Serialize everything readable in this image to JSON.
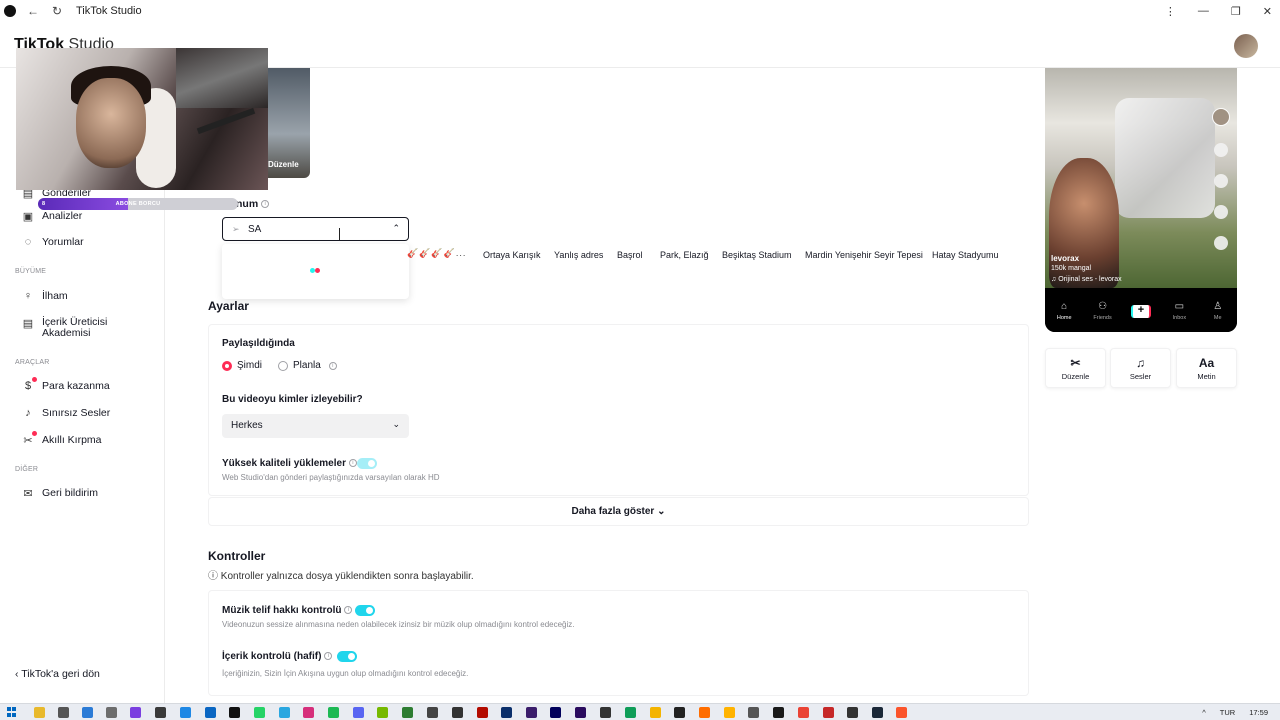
{
  "window": {
    "title": "TikTok Studio",
    "back_icon": "←",
    "reload_icon": "↻",
    "controls": [
      "⋮",
      "—",
      "❐",
      "✕"
    ]
  },
  "header": {
    "logo_text": "TikTok",
    "logo_suffix": "Studio"
  },
  "sidebar": {
    "items": [
      {
        "label": "Analizler",
        "icon": "analytics-icon",
        "glyph": "▣"
      },
      {
        "label": "Yorumlar",
        "icon": "comment-icon",
        "glyph": "◌"
      },
      {
        "label": "İlham",
        "icon": "lightbulb-icon",
        "glyph": "♀"
      },
      {
        "label": "İçerik Üreticisi",
        "label2": "Akademisi",
        "icon": "academy-icon",
        "glyph": "▤"
      },
      {
        "label": "Para kazanma",
        "icon": "money-icon",
        "glyph": "$"
      },
      {
        "label": "Sınırsız Sesler",
        "icon": "music-icon",
        "glyph": "♪"
      },
      {
        "label": "Akıllı Kırpma",
        "icon": "scissors-icon",
        "glyph": "✂"
      },
      {
        "label": "Geri bildirim",
        "icon": "feedback-icon",
        "glyph": "✉"
      }
    ],
    "sections": [
      "BÜYÜME",
      "ARAÇLAR",
      "DİĞER"
    ],
    "back_label": "TikTok'a geri dön",
    "partial_item": "Gönderiler"
  },
  "overlay": {
    "subscriber_label": "ABONE BORCU",
    "subscriber_count": "8",
    "subscriber_progress": 0.45,
    "thumb_label": "Düzenle"
  },
  "location": {
    "label": "Konum",
    "input_value": "SA",
    "chips": [
      "Ortaya Karışık",
      "Yanlış adres",
      "Başrol",
      "Park, Elazığ",
      "Beşiktaş Stadium",
      "Mardin Yenişehir Seyir Tepesi",
      "Hatay Stadyumu"
    ],
    "emoji_strip": "🎸🎸🎸🎸..."
  },
  "settings": {
    "title": "Ayarlar",
    "when_label": "Paylaşıldığında",
    "radio_now": "Şimdi",
    "radio_schedule": "Planla",
    "who_label": "Bu videoyu kimler izleyebilir?",
    "who_value": "Herkes",
    "hq_label": "Yüksek kaliteli yüklemeler",
    "hq_desc": "Web Studio'dan gönderi paylaştığınızda varsayılan olarak HD",
    "more_label": "Daha fazla göster"
  },
  "checks": {
    "title": "Kontroller",
    "note": "Kontroller yalnızca dosya yüklendikten sonra başlayabilir.",
    "music_label": "Müzik telif hakkı kontrolü",
    "music_desc": "Videonuzun sessize alınmasına neden olabilecek izinsiz bir müzik olup olmadığını kontrol edeceğiz.",
    "content_label": "İçerik kontrolü (hafif)",
    "content_desc": "İçeriğinizin, Sizin İçin Akışına uygun olup olmadığını kontrol edeceğiz."
  },
  "preview": {
    "username": "levorax",
    "caption": "150k mangal",
    "sound": "Orijinal ses - levorax",
    "nav": [
      "Home",
      "Friends",
      "",
      "Inbox",
      "Me"
    ],
    "buttons": [
      {
        "label": "Düzenle",
        "glyph": "✂",
        "icon": "scissors-icon"
      },
      {
        "label": "Sesler",
        "glyph": "♫",
        "icon": "music-icon"
      },
      {
        "label": "Metin",
        "glyph": "Aa",
        "icon": "text-icon"
      }
    ]
  },
  "taskbar": {
    "language": "TUR",
    "time": "17:59",
    "tray_icon": "^"
  }
}
